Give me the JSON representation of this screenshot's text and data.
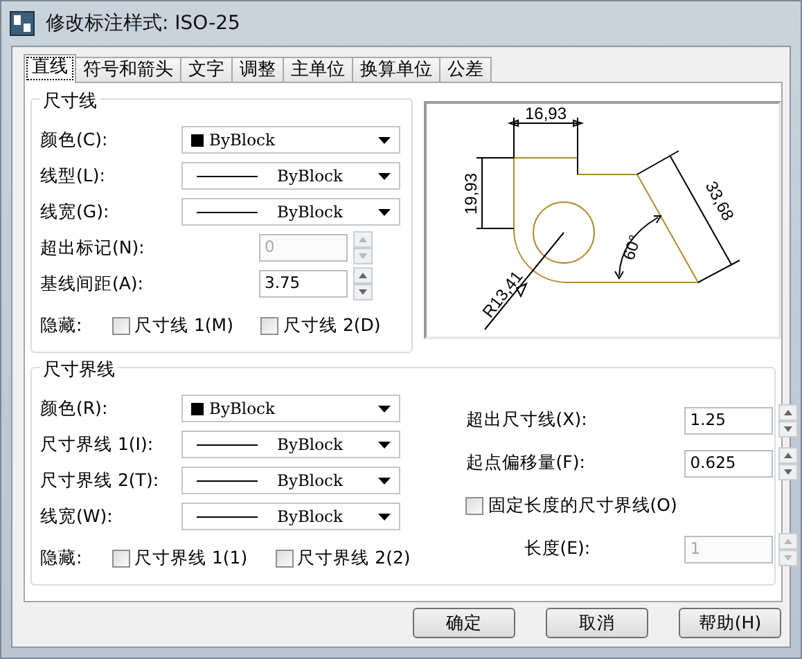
{
  "window": {
    "title": "修改标注样式: ISO-25"
  },
  "tabs": [
    {
      "label": "直线",
      "selected": true
    },
    {
      "label": "符号和箭头",
      "selected": false
    },
    {
      "label": "文字",
      "selected": false
    },
    {
      "label": "调整",
      "selected": false
    },
    {
      "label": "主单位",
      "selected": false
    },
    {
      "label": "换算单位",
      "selected": false
    },
    {
      "label": "公差",
      "selected": false
    }
  ],
  "dimension_lines": {
    "title": "尺寸线",
    "rows": [
      {
        "kind": "color",
        "label": "颜色(C):",
        "value": "ByBlock",
        "disabled": false
      },
      {
        "kind": "linetype",
        "label": "线型(L):",
        "value": "ByBlock",
        "disabled": false
      },
      {
        "kind": "linetype",
        "label": "线宽(G):",
        "value": "ByBlock",
        "disabled": false
      },
      {
        "kind": "spinner",
        "label": "超出标记(N):",
        "value": "0",
        "disabled": true
      },
      {
        "kind": "spinner",
        "label": "基线间距(A):",
        "value": "3.75",
        "disabled": false
      }
    ],
    "hide": {
      "label": "隐藏:",
      "checkboxes": [
        {
          "label": "尺寸线 1(M)",
          "checked": false
        },
        {
          "label": "尺寸线 2(D)",
          "checked": false
        }
      ]
    }
  },
  "preview": {
    "labels": [
      "16,93",
      "19,93",
      "33,68",
      "60°",
      "R13,41"
    ]
  },
  "extension_lines": {
    "title": "尺寸界线",
    "rows": [
      {
        "kind": "color",
        "label": "颜色(R):",
        "value": "ByBlock",
        "disabled": false
      },
      {
        "kind": "linetype",
        "label": "尺寸界线 1(I):",
        "value": "ByBlock",
        "disabled": false
      },
      {
        "kind": "linetype",
        "label": "尺寸界线 2(T):",
        "value": "ByBlock",
        "disabled": false
      },
      {
        "kind": "linetype",
        "label": "线宽(W):",
        "value": "ByBlock",
        "disabled": false
      }
    ],
    "hide": {
      "label": "隐藏:",
      "checkboxes": [
        {
          "label": "尺寸界线 1(1)",
          "checked": false
        },
        {
          "label": "尺寸界线 2(2)",
          "checked": false
        }
      ]
    },
    "options": [
      {
        "kind": "spinner",
        "label": "超出尺寸线(X):",
        "value": "1.25",
        "disabled": false
      },
      {
        "kind": "spinner",
        "label": "起点偏移量(F):",
        "value": "0.625",
        "disabled": false
      },
      {
        "kind": "checkbox",
        "label": "固定长度的尺寸界线(O)",
        "checked": false
      },
      {
        "kind": "spinner",
        "label": "长度(E):",
        "value": "1",
        "disabled": true
      }
    ]
  },
  "buttons": [
    "确定",
    "取消",
    "帮助(H)"
  ]
}
